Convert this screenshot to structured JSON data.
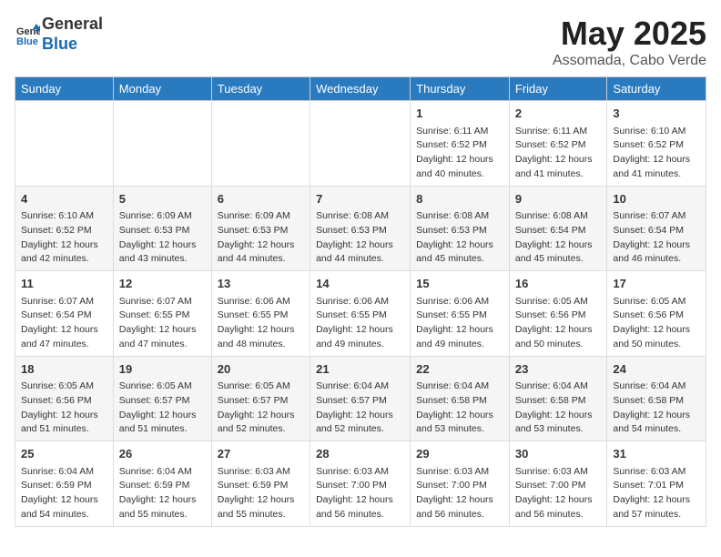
{
  "header": {
    "logo_line1": "General",
    "logo_line2": "Blue",
    "title": "May 2025",
    "location": "Assomada, Cabo Verde"
  },
  "weekdays": [
    "Sunday",
    "Monday",
    "Tuesday",
    "Wednesday",
    "Thursday",
    "Friday",
    "Saturday"
  ],
  "weeks": [
    [
      {
        "day": "",
        "info": ""
      },
      {
        "day": "",
        "info": ""
      },
      {
        "day": "",
        "info": ""
      },
      {
        "day": "",
        "info": ""
      },
      {
        "day": "1",
        "info": "Sunrise: 6:11 AM\nSunset: 6:52 PM\nDaylight: 12 hours\nand 40 minutes."
      },
      {
        "day": "2",
        "info": "Sunrise: 6:11 AM\nSunset: 6:52 PM\nDaylight: 12 hours\nand 41 minutes."
      },
      {
        "day": "3",
        "info": "Sunrise: 6:10 AM\nSunset: 6:52 PM\nDaylight: 12 hours\nand 41 minutes."
      }
    ],
    [
      {
        "day": "4",
        "info": "Sunrise: 6:10 AM\nSunset: 6:52 PM\nDaylight: 12 hours\nand 42 minutes."
      },
      {
        "day": "5",
        "info": "Sunrise: 6:09 AM\nSunset: 6:53 PM\nDaylight: 12 hours\nand 43 minutes."
      },
      {
        "day": "6",
        "info": "Sunrise: 6:09 AM\nSunset: 6:53 PM\nDaylight: 12 hours\nand 44 minutes."
      },
      {
        "day": "7",
        "info": "Sunrise: 6:08 AM\nSunset: 6:53 PM\nDaylight: 12 hours\nand 44 minutes."
      },
      {
        "day": "8",
        "info": "Sunrise: 6:08 AM\nSunset: 6:53 PM\nDaylight: 12 hours\nand 45 minutes."
      },
      {
        "day": "9",
        "info": "Sunrise: 6:08 AM\nSunset: 6:54 PM\nDaylight: 12 hours\nand 45 minutes."
      },
      {
        "day": "10",
        "info": "Sunrise: 6:07 AM\nSunset: 6:54 PM\nDaylight: 12 hours\nand 46 minutes."
      }
    ],
    [
      {
        "day": "11",
        "info": "Sunrise: 6:07 AM\nSunset: 6:54 PM\nDaylight: 12 hours\nand 47 minutes."
      },
      {
        "day": "12",
        "info": "Sunrise: 6:07 AM\nSunset: 6:55 PM\nDaylight: 12 hours\nand 47 minutes."
      },
      {
        "day": "13",
        "info": "Sunrise: 6:06 AM\nSunset: 6:55 PM\nDaylight: 12 hours\nand 48 minutes."
      },
      {
        "day": "14",
        "info": "Sunrise: 6:06 AM\nSunset: 6:55 PM\nDaylight: 12 hours\nand 49 minutes."
      },
      {
        "day": "15",
        "info": "Sunrise: 6:06 AM\nSunset: 6:55 PM\nDaylight: 12 hours\nand 49 minutes."
      },
      {
        "day": "16",
        "info": "Sunrise: 6:05 AM\nSunset: 6:56 PM\nDaylight: 12 hours\nand 50 minutes."
      },
      {
        "day": "17",
        "info": "Sunrise: 6:05 AM\nSunset: 6:56 PM\nDaylight: 12 hours\nand 50 minutes."
      }
    ],
    [
      {
        "day": "18",
        "info": "Sunrise: 6:05 AM\nSunset: 6:56 PM\nDaylight: 12 hours\nand 51 minutes."
      },
      {
        "day": "19",
        "info": "Sunrise: 6:05 AM\nSunset: 6:57 PM\nDaylight: 12 hours\nand 51 minutes."
      },
      {
        "day": "20",
        "info": "Sunrise: 6:05 AM\nSunset: 6:57 PM\nDaylight: 12 hours\nand 52 minutes."
      },
      {
        "day": "21",
        "info": "Sunrise: 6:04 AM\nSunset: 6:57 PM\nDaylight: 12 hours\nand 52 minutes."
      },
      {
        "day": "22",
        "info": "Sunrise: 6:04 AM\nSunset: 6:58 PM\nDaylight: 12 hours\nand 53 minutes."
      },
      {
        "day": "23",
        "info": "Sunrise: 6:04 AM\nSunset: 6:58 PM\nDaylight: 12 hours\nand 53 minutes."
      },
      {
        "day": "24",
        "info": "Sunrise: 6:04 AM\nSunset: 6:58 PM\nDaylight: 12 hours\nand 54 minutes."
      }
    ],
    [
      {
        "day": "25",
        "info": "Sunrise: 6:04 AM\nSunset: 6:59 PM\nDaylight: 12 hours\nand 54 minutes."
      },
      {
        "day": "26",
        "info": "Sunrise: 6:04 AM\nSunset: 6:59 PM\nDaylight: 12 hours\nand 55 minutes."
      },
      {
        "day": "27",
        "info": "Sunrise: 6:03 AM\nSunset: 6:59 PM\nDaylight: 12 hours\nand 55 minutes."
      },
      {
        "day": "28",
        "info": "Sunrise: 6:03 AM\nSunset: 7:00 PM\nDaylight: 12 hours\nand 56 minutes."
      },
      {
        "day": "29",
        "info": "Sunrise: 6:03 AM\nSunset: 7:00 PM\nDaylight: 12 hours\nand 56 minutes."
      },
      {
        "day": "30",
        "info": "Sunrise: 6:03 AM\nSunset: 7:00 PM\nDaylight: 12 hours\nand 56 minutes."
      },
      {
        "day": "31",
        "info": "Sunrise: 6:03 AM\nSunset: 7:01 PM\nDaylight: 12 hours\nand 57 minutes."
      }
    ]
  ]
}
